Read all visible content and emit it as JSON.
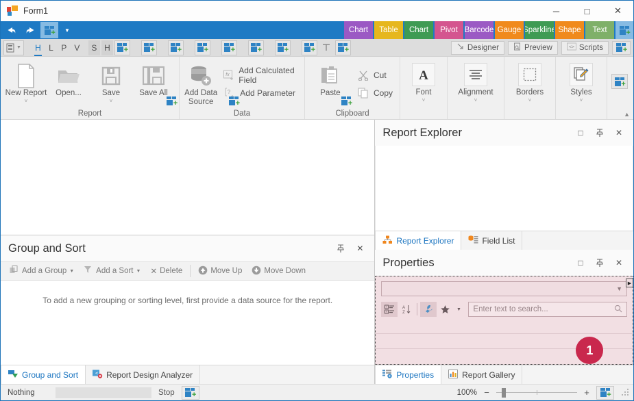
{
  "window": {
    "title": "Form1",
    "logo_icon": "app-squares-icon",
    "controls": [
      {
        "name": "minimize",
        "glyph": "─"
      },
      {
        "name": "maximize",
        "glyph": "□"
      },
      {
        "name": "close",
        "glyph": "✕"
      }
    ]
  },
  "quick_access": {
    "undo_icon": "undo-arrow-icon",
    "redo_icon": "redo-arrow-icon",
    "add_icon": "add-item-icon",
    "more_icon": "chevron-down-icon"
  },
  "ribbon_tabs": [
    {
      "label": "Chart",
      "color": "#9b59c4"
    },
    {
      "label": "Table",
      "color": "#e6b71e"
    },
    {
      "label": "Chart",
      "color": "#3f9b54"
    },
    {
      "label": "Pivot",
      "color": "#d4558f"
    },
    {
      "label": "Barcode",
      "color": "#9b59c4"
    },
    {
      "label": "Gauge",
      "color": "#f08a1c"
    },
    {
      "label": "Sparkline",
      "color": "#3f9b54"
    },
    {
      "label": "Shape",
      "color": "#f08a1c"
    },
    {
      "label": "Text",
      "color": "#7fb069"
    }
  ],
  "mini_toolbar": {
    "list_icon": "list-lines-icon",
    "letters": [
      {
        "label": "H",
        "active": true
      },
      {
        "label": "L",
        "active": false
      },
      {
        "label": "P",
        "active": false
      },
      {
        "label": "V",
        "active": false
      },
      {
        "label": "S",
        "active": false,
        "shaded": true
      },
      {
        "label": "H",
        "active": false,
        "shaded": true
      }
    ],
    "add_icon": "add-item-icon",
    "text_icon": "text-tool-icon",
    "mode_buttons": [
      {
        "label": "Designer",
        "icon": "designer-arrow-icon"
      },
      {
        "label": "Preview",
        "icon": "preview-page-icon"
      },
      {
        "label": "Scripts",
        "icon": "scripts-code-icon"
      }
    ],
    "trailing_add_icon": "add-item-icon"
  },
  "ribbon_groups": [
    {
      "name": "Report",
      "label": "Report",
      "big_buttons": [
        {
          "label": "New Report",
          "icon": "new-document-icon",
          "caret": true
        },
        {
          "label": "Open...",
          "icon": "open-folder-icon",
          "caret": false
        },
        {
          "label": "Save",
          "icon": "save-disk-icon",
          "caret": true
        },
        {
          "label": "Save All",
          "icon": "save-all-icon",
          "caret": false
        }
      ],
      "launcher_icon": "dialog-launcher-icon"
    },
    {
      "name": "Data",
      "label": "Data",
      "big_buttons": [
        {
          "label": "Add Data\nSource",
          "icon": "database-add-icon",
          "caret": false
        }
      ],
      "small_buttons": [
        {
          "label": "Add Calculated Field",
          "icon": "fx-add-icon"
        },
        {
          "label": "Add Parameter",
          "icon": "parameter-add-icon"
        }
      ],
      "launcher_icon": "dialog-launcher-icon"
    },
    {
      "name": "Clipboard",
      "label": "Clipboard",
      "big_buttons": [
        {
          "label": "Paste",
          "icon": "paste-clipboard-icon",
          "caret": false
        }
      ],
      "small_buttons": [
        {
          "label": "Cut",
          "icon": "scissors-icon"
        },
        {
          "label": "Copy",
          "icon": "copy-pages-icon"
        }
      ],
      "launcher_icon": "dialog-launcher-icon"
    },
    {
      "name": "Font",
      "label": "",
      "big_buttons": [
        {
          "label": "Font",
          "icon": "font-letter-a-icon",
          "caret": true
        }
      ]
    },
    {
      "name": "Alignment",
      "label": "",
      "big_buttons": [
        {
          "label": "Alignment",
          "icon": "align-lines-icon",
          "caret": true
        }
      ]
    },
    {
      "name": "Borders",
      "label": "",
      "big_buttons": [
        {
          "label": "Borders",
          "icon": "borders-box-icon",
          "caret": true
        }
      ]
    },
    {
      "name": "Styles",
      "label": "",
      "big_buttons": [
        {
          "label": "Styles",
          "icon": "styles-brush-icon",
          "caret": true
        }
      ]
    }
  ],
  "ribbon_extra_add_icon": "add-item-icon",
  "ribbon_collapse_icon": "chevron-up-icon",
  "group_and_sort": {
    "title": "Group and Sort",
    "pin_icon": "pin-icon",
    "close_icon": "close-icon",
    "toolbar": [
      {
        "label": "Add a Group",
        "icon": "add-group-icon",
        "caret": true
      },
      {
        "label": "Add a Sort",
        "icon": "add-sort-icon",
        "caret": true
      },
      {
        "label": "Delete",
        "icon": "delete-x-icon",
        "caret": false
      },
      {
        "label": "Move Up",
        "icon": "move-up-icon",
        "caret": false
      },
      {
        "label": "Move Down",
        "icon": "move-down-icon",
        "caret": false
      }
    ],
    "empty_message": "To add a new grouping or sorting level, first provide a data source for the report.",
    "tabs": [
      {
        "label": "Group and Sort",
        "icon": "group-sort-icon",
        "active": true
      },
      {
        "label": "Report Design Analyzer",
        "icon": "design-analyzer-icon",
        "active": false
      }
    ]
  },
  "report_explorer": {
    "title": "Report Explorer",
    "restore_icon": "restore-window-icon",
    "pin_icon": "pin-icon",
    "close_icon": "close-icon",
    "tabs": [
      {
        "label": "Report Explorer",
        "icon": "report-explorer-icon",
        "active": true
      },
      {
        "label": "Field List",
        "icon": "field-list-icon",
        "active": false
      }
    ]
  },
  "properties": {
    "title": "Properties",
    "restore_icon": "restore-window-icon",
    "pin_icon": "pin-icon",
    "close_icon": "close-icon",
    "object_combo_value": "",
    "object_combo_caret": "chevron-down-icon",
    "tools": [
      {
        "name": "categorized-button",
        "icon": "categorized-icon",
        "pressed": true
      },
      {
        "name": "alphabetical-button",
        "icon": "sort-az-icon",
        "pressed": false
      },
      {
        "name": "properties-button",
        "icon": "wrench-icon",
        "pressed": true
      },
      {
        "name": "favorites-button",
        "icon": "star-icon",
        "pressed": false
      },
      {
        "name": "favorites-dropdown",
        "icon": "chevron-down-icon",
        "pressed": false
      }
    ],
    "search_placeholder": "Enter text to search...",
    "search_value": "",
    "search_icon": "magnifier-icon",
    "expand_arrow_icon": "expand-right-icon",
    "callout_badge": "1",
    "callout_color": "#c9284d",
    "highlight_color": "#f2dfe3",
    "tabs": [
      {
        "label": "Properties",
        "icon": "properties-grid-icon",
        "active": true
      },
      {
        "label": "Report Gallery",
        "icon": "report-gallery-icon",
        "active": false
      }
    ]
  },
  "status_bar": {
    "message": "Nothing",
    "stop_label": "Stop",
    "add_icon": "add-item-icon",
    "zoom_percent": "100%",
    "zoom_minus": "−",
    "zoom_plus": "+",
    "grip_icon": "resize-grip-icon"
  }
}
